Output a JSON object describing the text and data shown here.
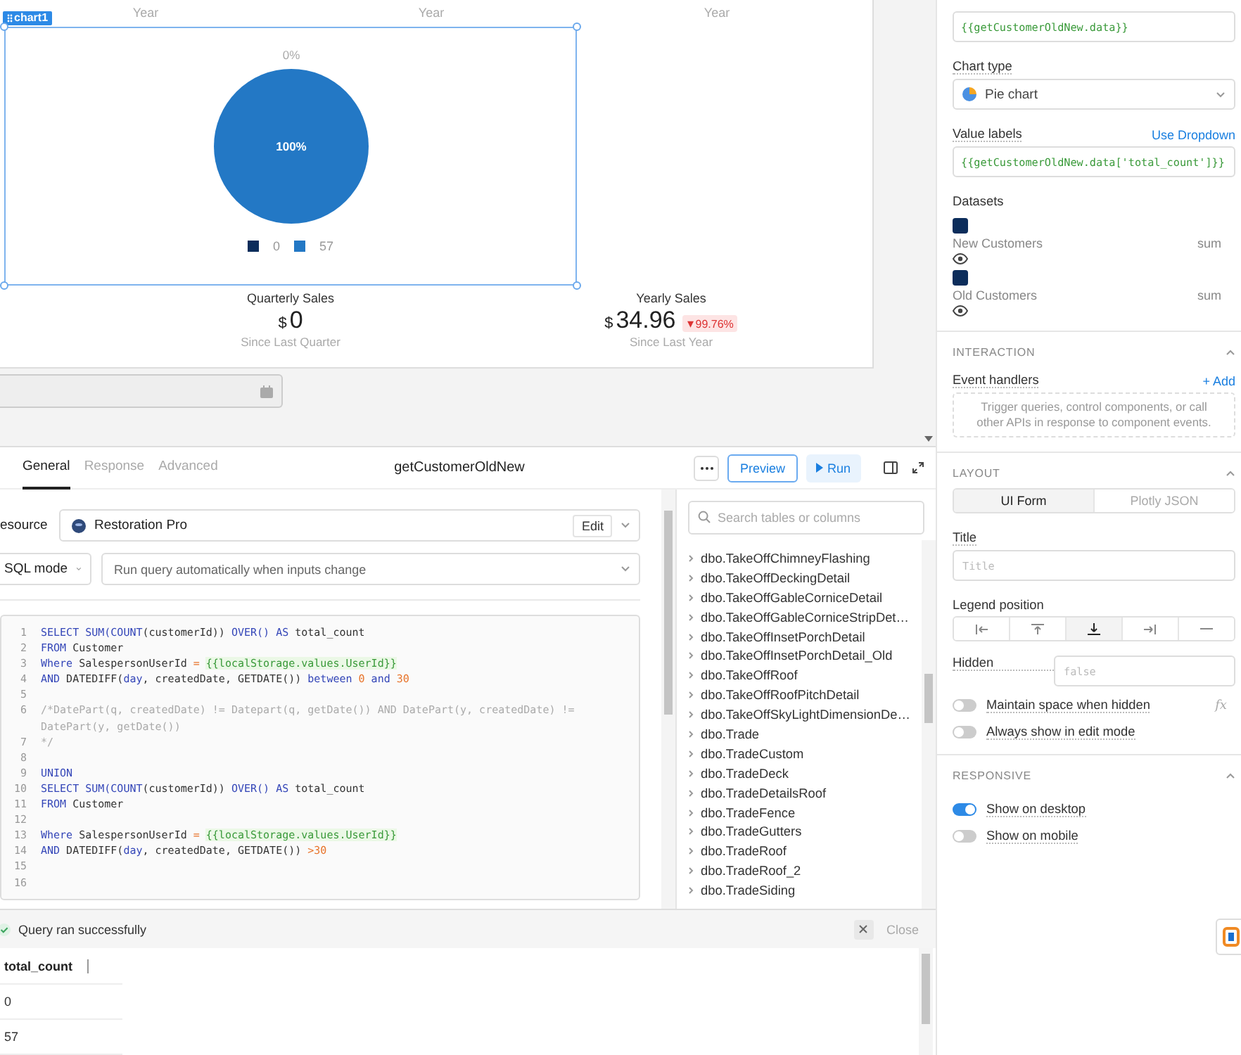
{
  "canvas": {
    "year_labels": [
      "Year",
      "Year",
      "Year"
    ],
    "chart": {
      "widget_label": "chart1",
      "slices": [
        {
          "color": "#0c2d5b"
        },
        {
          "color": "#2378c5"
        }
      ],
      "chart_data": {
        "type": "pie",
        "categories": [
          "0",
          "57"
        ],
        "values": [
          0,
          100
        ],
        "value_labels": [
          "0%",
          "100%"
        ]
      }
    },
    "stats": [
      {
        "title": "Quarterly Sales",
        "currency": "$",
        "value": "0",
        "caption": "Since Last Quarter"
      },
      {
        "title": "Yearly Sales",
        "currency": "$",
        "value": "34.96",
        "change_arrow": "▾",
        "change": "99.76%",
        "caption": "Since Last Year"
      }
    ]
  },
  "query": {
    "tabs": [
      {
        "label": "General",
        "selected": true
      },
      {
        "label": "Response",
        "selected": false
      },
      {
        "label": "Advanced",
        "selected": false
      }
    ],
    "title": "getCustomerOldNew",
    "preview": "Preview",
    "run": "Run",
    "resource": {
      "label": "esource",
      "value": "Restoration Pro",
      "edit": "Edit"
    },
    "mode": "SQL mode",
    "trigger": "Run query automatically when inputs change",
    "code": [
      {
        "number": "1",
        "tokens": [
          {
            "kind": "kw",
            "text": "SELECT SUM(COUNT"
          },
          {
            "kind": "plain",
            "text": "(customerId)) "
          },
          {
            "kind": "kw",
            "text": "OVER() AS"
          },
          {
            "kind": "plain",
            "text": " total_count"
          }
        ]
      },
      {
        "number": "2",
        "tokens": [
          {
            "kind": "kw",
            "text": "FROM"
          },
          {
            "kind": "plain",
            "text": " Customer"
          }
        ]
      },
      {
        "number": "3",
        "tokens": [
          {
            "kind": "kw",
            "text": "Where"
          },
          {
            "kind": "plain",
            "text": " SalespersonUserId "
          },
          {
            "kind": "op",
            "text": "= "
          },
          {
            "kind": "tpl",
            "text": "{{localStorage.values.UserId}}"
          }
        ]
      },
      {
        "number": "4",
        "tokens": [
          {
            "kind": "kw",
            "text": "AND"
          },
          {
            "kind": "plain",
            "text": " DATEDIFF("
          },
          {
            "kind": "kw",
            "text": "day"
          },
          {
            "kind": "plain",
            "text": ", createdDate, GETDATE()) "
          },
          {
            "kind": "kw",
            "text": "between"
          },
          {
            "kind": "num",
            "text": " 0"
          },
          {
            "kind": "kw",
            "text": " and"
          },
          {
            "kind": "num",
            "text": " 30"
          }
        ]
      },
      {
        "number": "5"
      },
      {
        "number": "6",
        "tokens": [
          {
            "kind": "comment",
            "text": "/*DatePart(q, createdDate) != Datepart(q, getDate()) AND DatePart(y, createdDate) != DatePart(y, getDate())"
          }
        ]
      },
      {
        "number": "7",
        "tokens": [
          {
            "kind": "comment",
            "text": "*/"
          }
        ]
      },
      {
        "number": "8"
      },
      {
        "number": "9",
        "tokens": [
          {
            "kind": "kw",
            "text": "UNION"
          }
        ]
      },
      {
        "number": "10",
        "tokens": [
          {
            "kind": "kw",
            "text": "SELECT SUM(COUNT"
          },
          {
            "kind": "plain",
            "text": "(customerId)) "
          },
          {
            "kind": "kw",
            "text": "OVER() AS"
          },
          {
            "kind": "plain",
            "text": " total_count"
          }
        ]
      },
      {
        "number": "11",
        "tokens": [
          {
            "kind": "kw",
            "text": "FROM"
          },
          {
            "kind": "plain",
            "text": " Customer"
          }
        ]
      },
      {
        "number": "12"
      },
      {
        "number": "13",
        "tokens": [
          {
            "kind": "kw",
            "text": "Where"
          },
          {
            "kind": "plain",
            "text": " SalespersonUserId "
          },
          {
            "kind": "op",
            "text": "= "
          },
          {
            "kind": "tpl",
            "text": "{{localStorage.values.UserId}}"
          }
        ]
      },
      {
        "number": "14",
        "tokens": [
          {
            "kind": "kw",
            "text": "AND"
          },
          {
            "kind": "plain",
            "text": " DATEDIFF("
          },
          {
            "kind": "kw",
            "text": "day"
          },
          {
            "kind": "plain",
            "text": ", createdDate, GETDATE()) "
          },
          {
            "kind": "num",
            "text": ">30"
          }
        ]
      },
      {
        "number": "15"
      },
      {
        "number": "16"
      }
    ],
    "schema": {
      "search_placeholder": "Search tables or columns",
      "tables": [
        "dbo.TakeOffChimneyFlashing",
        "dbo.TakeOffDeckingDetail",
        "dbo.TakeOffGableCorniceDetail",
        "dbo.TakeOffGableCorniceStripDet…",
        "dbo.TakeOffInsetPorchDetail",
        "dbo.TakeOffInsetPorchDetail_Old",
        "dbo.TakeOffRoof",
        "dbo.TakeOffRoofPitchDetail",
        "dbo.TakeOffSkyLightDimensionDe…",
        "dbo.Trade",
        "dbo.TradeCustom",
        "dbo.TradeDeck",
        "dbo.TradeDetailsRoof",
        "dbo.TradeFence",
        "dbo.TradeGutters",
        "dbo.TradeRoof",
        "dbo.TradeRoof_2",
        "dbo.TradeSiding"
      ]
    },
    "results": {
      "status": "Query ran successfully",
      "close": "Close",
      "columns": [
        "total_count"
      ],
      "rows": [
        [
          "0"
        ],
        [
          "57"
        ]
      ]
    }
  },
  "inspector": {
    "data_source_value": "{{getCustomerOldNew.data}}",
    "chart_type": {
      "label": "Chart type",
      "value": "Pie chart"
    },
    "value_labels": {
      "label": "Value labels",
      "link": "Use Dropdown",
      "value": "{{getCustomerOldNew.data['total_count']}}"
    },
    "datasets": {
      "label": "Datasets",
      "items": [
        {
          "name": "New Customers",
          "aggregate": "sum",
          "color": "#0c2d5b",
          "visible": true
        },
        {
          "name": "Old Customers",
          "aggregate": "sum",
          "color": "#0c2d5b",
          "visible": true
        }
      ]
    },
    "interaction": {
      "heading": "INTERACTION",
      "event_handlers": "Event handlers",
      "add": "+ Add",
      "empty_hint": "Trigger queries, control components, or call other APIs in response to component events."
    },
    "layout": {
      "heading": "LAYOUT",
      "modes": [
        {
          "label": "UI Form",
          "selected": true
        },
        {
          "label": "Plotly JSON",
          "selected": false
        }
      ],
      "title": {
        "label": "Title",
        "placeholder": "Title"
      },
      "legend_position": {
        "label": "Legend position",
        "options": [
          {
            "kind": "left",
            "selected": false
          },
          {
            "kind": "top",
            "selected": false
          },
          {
            "kind": "bottom",
            "selected": true
          },
          {
            "kind": "right",
            "selected": false
          },
          {
            "kind": "none",
            "selected": false
          }
        ]
      },
      "hidden": {
        "label": "Hidden",
        "placeholder": "false"
      },
      "toggles": [
        {
          "label": "Maintain space when hidden",
          "on": false,
          "formula": "fx"
        },
        {
          "label": "Always show in edit mode",
          "on": false
        }
      ]
    },
    "responsive": {
      "heading": "RESPONSIVE",
      "toggles": [
        {
          "label": "Show on desktop",
          "on": true
        },
        {
          "label": "Show on mobile",
          "on": false
        }
      ]
    }
  }
}
